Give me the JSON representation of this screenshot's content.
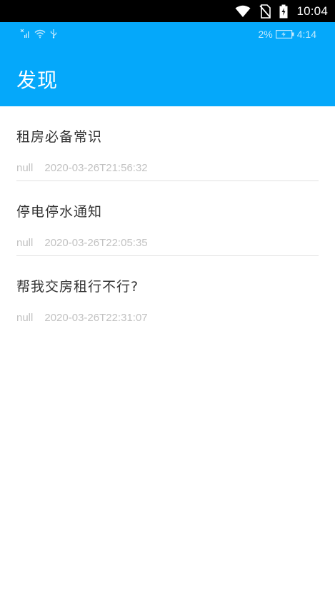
{
  "system_status": {
    "time": "10:04",
    "icons": [
      "wifi-icon",
      "no-sim-icon",
      "battery-charging-icon"
    ]
  },
  "app_status": {
    "battery_percent": "2%",
    "time": "4:14",
    "icons": [
      "signal-off-icon",
      "wifi-icon",
      "usb-icon",
      "battery-charging-icon"
    ]
  },
  "header": {
    "title": "发现",
    "background_color": "#05a8fa"
  },
  "articles": [
    {
      "title": "租房必备常识",
      "author": "null",
      "date": "2020-03-26T21:56:32"
    },
    {
      "title": "停电停水通知",
      "author": "null",
      "date": "2020-03-26T22:05:35"
    },
    {
      "title": "帮我交房租行不行?",
      "author": "null",
      "date": "2020-03-26T22:31:07"
    }
  ]
}
